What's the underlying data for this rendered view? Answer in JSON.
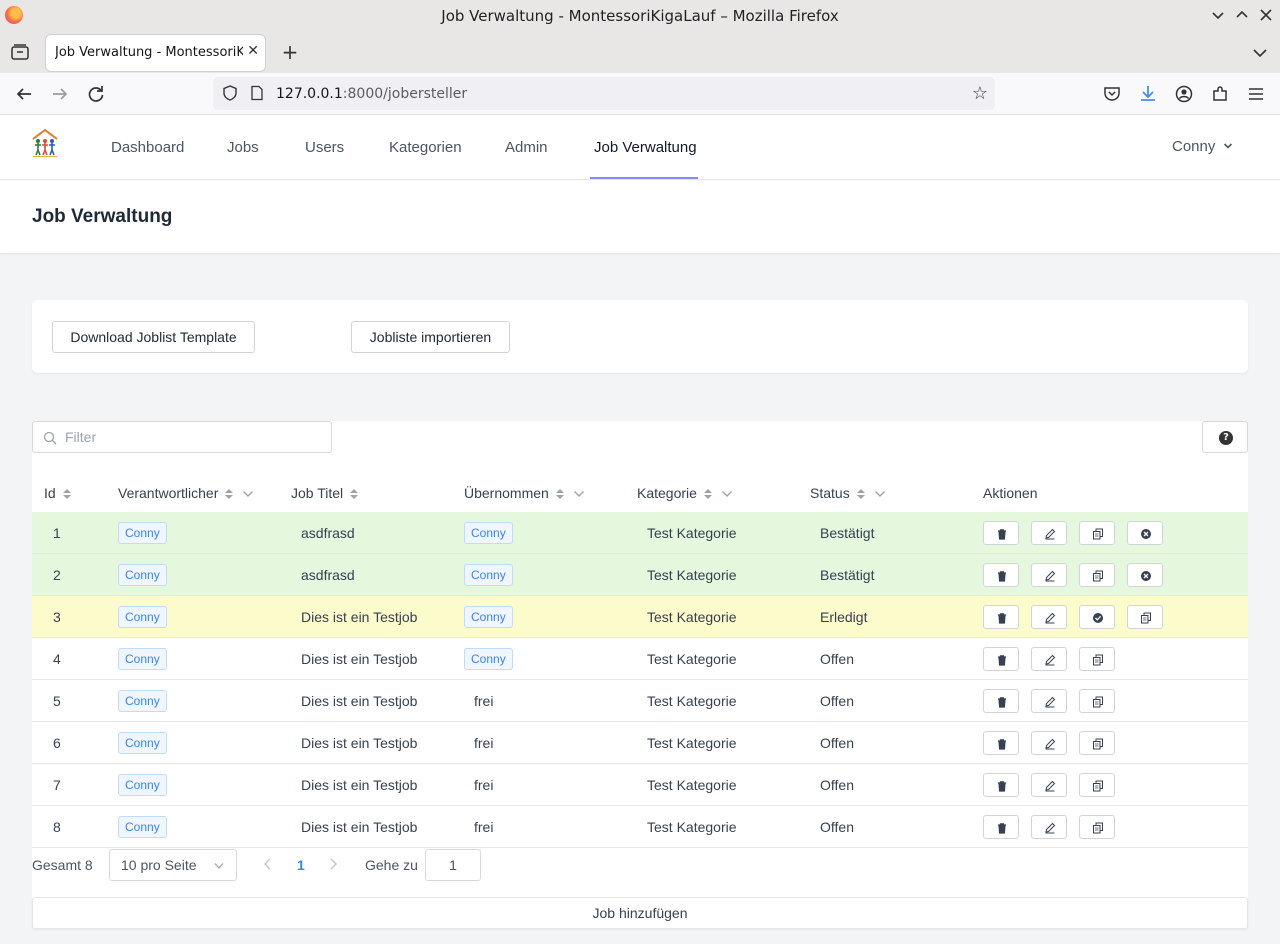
{
  "browser": {
    "window_title": "Job Verwaltung - MontessoriKigaLauf – Mozilla Firefox",
    "tab_title": "Job Verwaltung - MontessoriKigaLauf",
    "url_host": "127.0.0.1",
    "url_rest": ":8000/jobersteller"
  },
  "nav": {
    "links": [
      "Dashboard",
      "Jobs",
      "Users",
      "Kategorien",
      "Admin",
      "Job Verwaltung"
    ],
    "active": "Job Verwaltung",
    "user": "Conny"
  },
  "page": {
    "title": "Job Verwaltung"
  },
  "actions": {
    "download_label": "Download Joblist Template",
    "import_label": "Jobliste importieren"
  },
  "table": {
    "filter_placeholder": "Filter",
    "columns": {
      "id": "Id",
      "owner": "Verantwortlicher",
      "title": "Job Titel",
      "taken": "Übernommen",
      "category": "Kategorie",
      "status": "Status",
      "actions": "Aktionen"
    },
    "rows": [
      {
        "id": "1",
        "owner": "Conny",
        "title": "asdfrasd",
        "taken": "Conny",
        "taken_tag": true,
        "category": "Test Kategorie",
        "status": "Bestätigt",
        "bg": "#e5f7dd"
      },
      {
        "id": "2",
        "owner": "Conny",
        "title": "asdfrasd",
        "taken": "Conny",
        "taken_tag": true,
        "category": "Test Kategorie",
        "status": "Bestätigt",
        "bg": "#e5f7dd"
      },
      {
        "id": "3",
        "owner": "Conny",
        "title": "Dies ist ein Testjob",
        "taken": "Conny",
        "taken_tag": true,
        "category": "Test Kategorie",
        "status": "Erledigt",
        "bg": "#fbfbcc"
      },
      {
        "id": "4",
        "owner": "Conny",
        "title": "Dies ist ein Testjob",
        "taken": "Conny",
        "taken_tag": true,
        "category": "Test Kategorie",
        "status": "Offen",
        "bg": "#ffffff"
      },
      {
        "id": "5",
        "owner": "Conny",
        "title": "Dies ist ein Testjob",
        "taken": "frei",
        "taken_tag": false,
        "category": "Test Kategorie",
        "status": "Offen",
        "bg": "#ffffff"
      },
      {
        "id": "6",
        "owner": "Conny",
        "title": "Dies ist ein Testjob",
        "taken": "frei",
        "taken_tag": false,
        "category": "Test Kategorie",
        "status": "Offen",
        "bg": "#ffffff"
      },
      {
        "id": "7",
        "owner": "Conny",
        "title": "Dies ist ein Testjob",
        "taken": "frei",
        "taken_tag": false,
        "category": "Test Kategorie",
        "status": "Offen",
        "bg": "#ffffff"
      },
      {
        "id": "8",
        "owner": "Conny",
        "title": "Dies ist ein Testjob",
        "taken": "frei",
        "taken_tag": false,
        "category": "Test Kategorie",
        "status": "Offen",
        "bg": "#ffffff"
      }
    ],
    "row_actions": [
      [
        "trash-icon",
        "edit-icon",
        "copy-icon",
        "reject-icon"
      ],
      [
        "trash-icon",
        "edit-icon",
        "copy-icon",
        "reject-icon"
      ],
      [
        "trash-icon",
        "edit-icon",
        "confirm-icon",
        "copy-icon"
      ],
      [
        "trash-icon",
        "edit-icon",
        "copy-icon"
      ],
      [
        "trash-icon",
        "edit-icon",
        "copy-icon"
      ],
      [
        "trash-icon",
        "edit-icon",
        "copy-icon"
      ],
      [
        "trash-icon",
        "edit-icon",
        "copy-icon"
      ],
      [
        "trash-icon",
        "edit-icon",
        "copy-icon"
      ]
    ]
  },
  "pagination": {
    "total_label": "Gesamt 8",
    "page_size": "10 pro Seite",
    "current_page": "1",
    "goto_label": "Gehe zu",
    "goto_value": "1"
  },
  "add_job_label": "Job hinzufügen"
}
